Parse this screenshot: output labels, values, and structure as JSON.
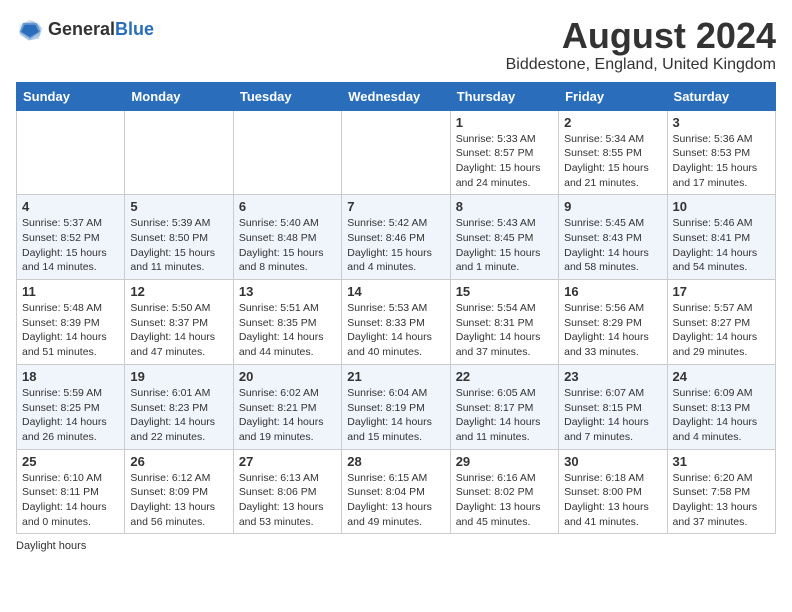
{
  "header": {
    "logo_general": "General",
    "logo_blue": "Blue",
    "title": "August 2024",
    "subtitle": "Biddestone, England, United Kingdom"
  },
  "weekdays": [
    "Sunday",
    "Monday",
    "Tuesday",
    "Wednesday",
    "Thursday",
    "Friday",
    "Saturday"
  ],
  "weeks": [
    [
      {
        "day": "",
        "info": ""
      },
      {
        "day": "",
        "info": ""
      },
      {
        "day": "",
        "info": ""
      },
      {
        "day": "",
        "info": ""
      },
      {
        "day": "1",
        "info": "Sunrise: 5:33 AM\nSunset: 8:57 PM\nDaylight: 15 hours\nand 24 minutes."
      },
      {
        "day": "2",
        "info": "Sunrise: 5:34 AM\nSunset: 8:55 PM\nDaylight: 15 hours\nand 21 minutes."
      },
      {
        "day": "3",
        "info": "Sunrise: 5:36 AM\nSunset: 8:53 PM\nDaylight: 15 hours\nand 17 minutes."
      }
    ],
    [
      {
        "day": "4",
        "info": "Sunrise: 5:37 AM\nSunset: 8:52 PM\nDaylight: 15 hours\nand 14 minutes."
      },
      {
        "day": "5",
        "info": "Sunrise: 5:39 AM\nSunset: 8:50 PM\nDaylight: 15 hours\nand 11 minutes."
      },
      {
        "day": "6",
        "info": "Sunrise: 5:40 AM\nSunset: 8:48 PM\nDaylight: 15 hours\nand 8 minutes."
      },
      {
        "day": "7",
        "info": "Sunrise: 5:42 AM\nSunset: 8:46 PM\nDaylight: 15 hours\nand 4 minutes."
      },
      {
        "day": "8",
        "info": "Sunrise: 5:43 AM\nSunset: 8:45 PM\nDaylight: 15 hours\nand 1 minute."
      },
      {
        "day": "9",
        "info": "Sunrise: 5:45 AM\nSunset: 8:43 PM\nDaylight: 14 hours\nand 58 minutes."
      },
      {
        "day": "10",
        "info": "Sunrise: 5:46 AM\nSunset: 8:41 PM\nDaylight: 14 hours\nand 54 minutes."
      }
    ],
    [
      {
        "day": "11",
        "info": "Sunrise: 5:48 AM\nSunset: 8:39 PM\nDaylight: 14 hours\nand 51 minutes."
      },
      {
        "day": "12",
        "info": "Sunrise: 5:50 AM\nSunset: 8:37 PM\nDaylight: 14 hours\nand 47 minutes."
      },
      {
        "day": "13",
        "info": "Sunrise: 5:51 AM\nSunset: 8:35 PM\nDaylight: 14 hours\nand 44 minutes."
      },
      {
        "day": "14",
        "info": "Sunrise: 5:53 AM\nSunset: 8:33 PM\nDaylight: 14 hours\nand 40 minutes."
      },
      {
        "day": "15",
        "info": "Sunrise: 5:54 AM\nSunset: 8:31 PM\nDaylight: 14 hours\nand 37 minutes."
      },
      {
        "day": "16",
        "info": "Sunrise: 5:56 AM\nSunset: 8:29 PM\nDaylight: 14 hours\nand 33 minutes."
      },
      {
        "day": "17",
        "info": "Sunrise: 5:57 AM\nSunset: 8:27 PM\nDaylight: 14 hours\nand 29 minutes."
      }
    ],
    [
      {
        "day": "18",
        "info": "Sunrise: 5:59 AM\nSunset: 8:25 PM\nDaylight: 14 hours\nand 26 minutes."
      },
      {
        "day": "19",
        "info": "Sunrise: 6:01 AM\nSunset: 8:23 PM\nDaylight: 14 hours\nand 22 minutes."
      },
      {
        "day": "20",
        "info": "Sunrise: 6:02 AM\nSunset: 8:21 PM\nDaylight: 14 hours\nand 19 minutes."
      },
      {
        "day": "21",
        "info": "Sunrise: 6:04 AM\nSunset: 8:19 PM\nDaylight: 14 hours\nand 15 minutes."
      },
      {
        "day": "22",
        "info": "Sunrise: 6:05 AM\nSunset: 8:17 PM\nDaylight: 14 hours\nand 11 minutes."
      },
      {
        "day": "23",
        "info": "Sunrise: 6:07 AM\nSunset: 8:15 PM\nDaylight: 14 hours\nand 7 minutes."
      },
      {
        "day": "24",
        "info": "Sunrise: 6:09 AM\nSunset: 8:13 PM\nDaylight: 14 hours\nand 4 minutes."
      }
    ],
    [
      {
        "day": "25",
        "info": "Sunrise: 6:10 AM\nSunset: 8:11 PM\nDaylight: 14 hours\nand 0 minutes."
      },
      {
        "day": "26",
        "info": "Sunrise: 6:12 AM\nSunset: 8:09 PM\nDaylight: 13 hours\nand 56 minutes."
      },
      {
        "day": "27",
        "info": "Sunrise: 6:13 AM\nSunset: 8:06 PM\nDaylight: 13 hours\nand 53 minutes."
      },
      {
        "day": "28",
        "info": "Sunrise: 6:15 AM\nSunset: 8:04 PM\nDaylight: 13 hours\nand 49 minutes."
      },
      {
        "day": "29",
        "info": "Sunrise: 6:16 AM\nSunset: 8:02 PM\nDaylight: 13 hours\nand 45 minutes."
      },
      {
        "day": "30",
        "info": "Sunrise: 6:18 AM\nSunset: 8:00 PM\nDaylight: 13 hours\nand 41 minutes."
      },
      {
        "day": "31",
        "info": "Sunrise: 6:20 AM\nSunset: 7:58 PM\nDaylight: 13 hours\nand 37 minutes."
      }
    ]
  ],
  "footer": {
    "note": "Daylight hours"
  }
}
